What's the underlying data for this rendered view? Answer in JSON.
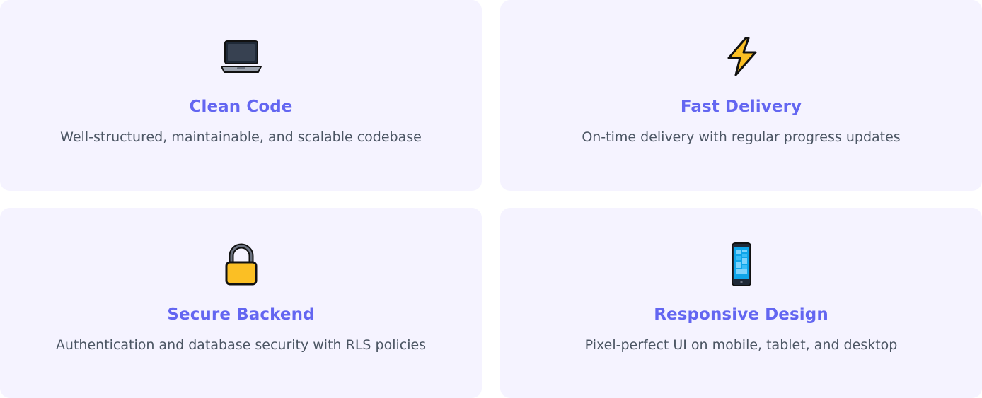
{
  "features": [
    {
      "icon": "laptop-icon",
      "title": "Clean Code",
      "description": "Well-structured, maintainable, and scalable codebase"
    },
    {
      "icon": "lightning-icon",
      "title": "Fast Delivery",
      "description": "On-time delivery with regular progress updates"
    },
    {
      "icon": "lock-icon",
      "title": "Secure Backend",
      "description": "Authentication and database security with RLS policies"
    },
    {
      "icon": "mobile-phone-icon",
      "title": "Responsive Design",
      "description": "Pixel-perfect UI on mobile, tablet, and desktop"
    }
  ],
  "colors": {
    "card_background": "#f5f3ff",
    "title": "#6366f1",
    "description": "#4b5563"
  }
}
